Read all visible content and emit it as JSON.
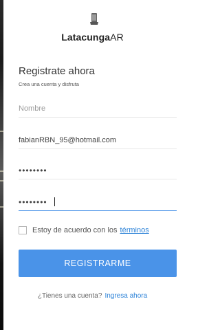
{
  "brand": {
    "name_bold": "Latacunga",
    "name_regular": "AR",
    "icon": "phone-ar-icon"
  },
  "form": {
    "title": "Registrate ahora",
    "subtitle": "Crea una cuenta y disfruta",
    "name_placeholder": "Nombre",
    "email_value": "fabianRBN_95@hotmail.com",
    "password_value": "••••••••",
    "confirm_password_value": "••••••••"
  },
  "agree": {
    "text": "Estoy de acuerdo con los",
    "link": "términos",
    "checked": false
  },
  "register_button": {
    "label": "REGISTRARME"
  },
  "footer": {
    "question": "¿Tienes una cuenta?",
    "link": "Ingresa ahora"
  },
  "colors": {
    "accent": "#4a93e8",
    "link": "#2d83d8",
    "text": "#333333"
  }
}
